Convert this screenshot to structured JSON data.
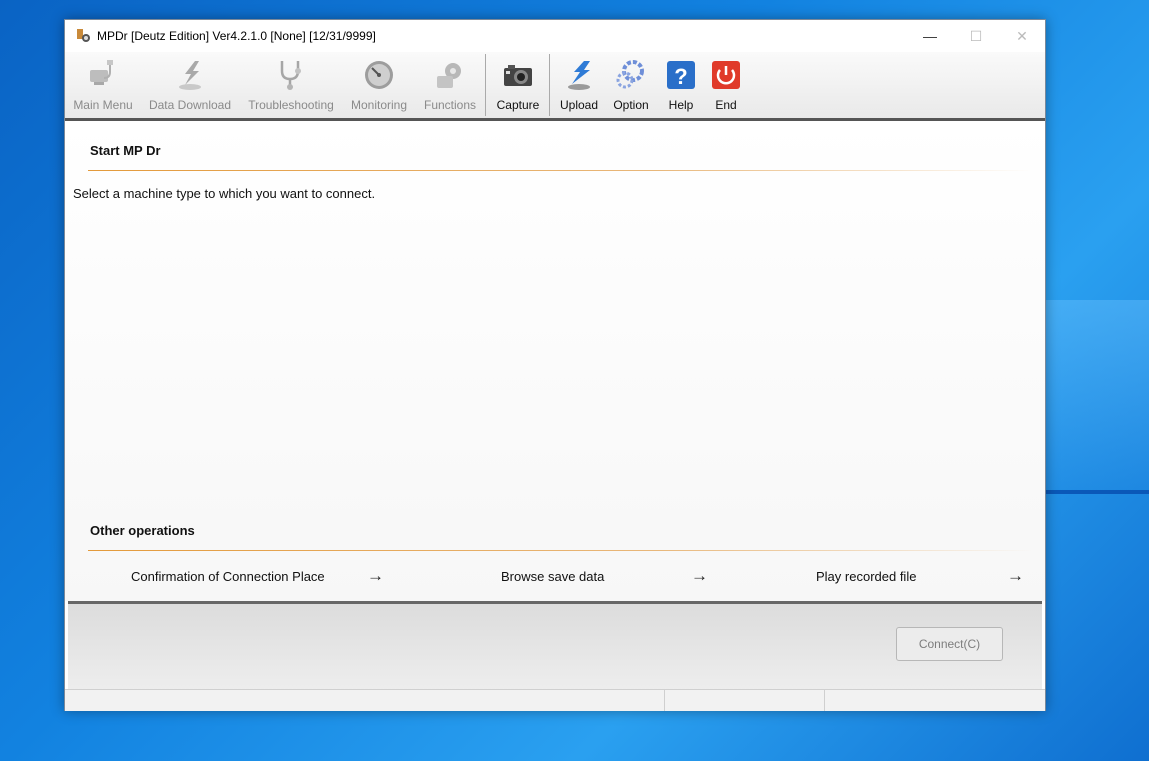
{
  "window": {
    "title": "MPDr [Deutz Edition] Ver4.2.1.0 [None] [12/31/9999]",
    "controls": {
      "minimize": "—",
      "maximize": "☐",
      "close": "✕"
    }
  },
  "toolbar": {
    "main_menu": "Main Menu",
    "data_download": "Data Download",
    "troubleshooting": "Troubleshooting",
    "monitoring": "Monitoring",
    "functions": "Functions",
    "capture": "Capture",
    "upload": "Upload",
    "option": "Option",
    "help": "Help",
    "end": "End"
  },
  "start": {
    "heading": "Start MP Dr",
    "instruction": "Select a machine type to which you want to connect."
  },
  "other_operations": {
    "heading": "Other operations",
    "items": [
      {
        "label": "Confirmation of Connection Place",
        "arrow": "→"
      },
      {
        "label": "Browse save data",
        "arrow": "→"
      },
      {
        "label": "Play recorded file",
        "arrow": "→"
      }
    ]
  },
  "footer": {
    "connect_label": "Connect(C)"
  },
  "colors": {
    "accent_rule": "#e39a3b",
    "end_red": "#e03a2a",
    "help_blue": "#2a6fc9"
  }
}
